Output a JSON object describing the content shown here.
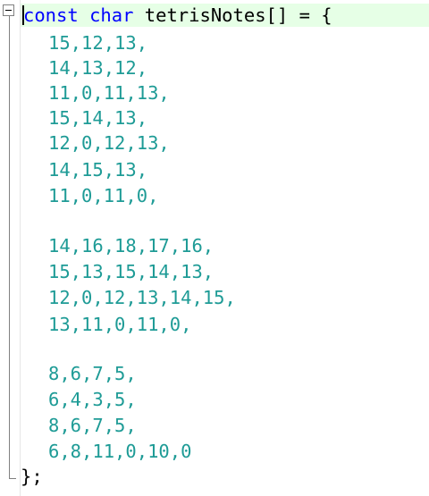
{
  "editor": {
    "declaration": {
      "keyword_const": "const",
      "keyword_char": "char",
      "name": "tetrisNotes[] = {"
    },
    "rows": [
      "15,12,13,",
      "14,13,12,",
      "11,0,11,13,",
      "15,14,13,",
      "12,0,12,13,",
      "14,15,13,",
      "11,0,11,0,",
      "",
      "14,16,18,17,16,",
      "15,13,15,14,13,",
      "12,0,12,13,14,15,",
      "13,11,0,11,0,",
      "",
      "8,6,7,5,",
      "6,4,3,5,",
      "8,6,7,5,",
      "6,8,11,0,10,0"
    ],
    "closing": "};"
  },
  "colors": {
    "keyword": "#0000ff",
    "number": "#1e9b96",
    "current_line_highlight": "#e6ffe6"
  },
  "icons": {
    "fold_marker": "fold-collapse-icon"
  }
}
